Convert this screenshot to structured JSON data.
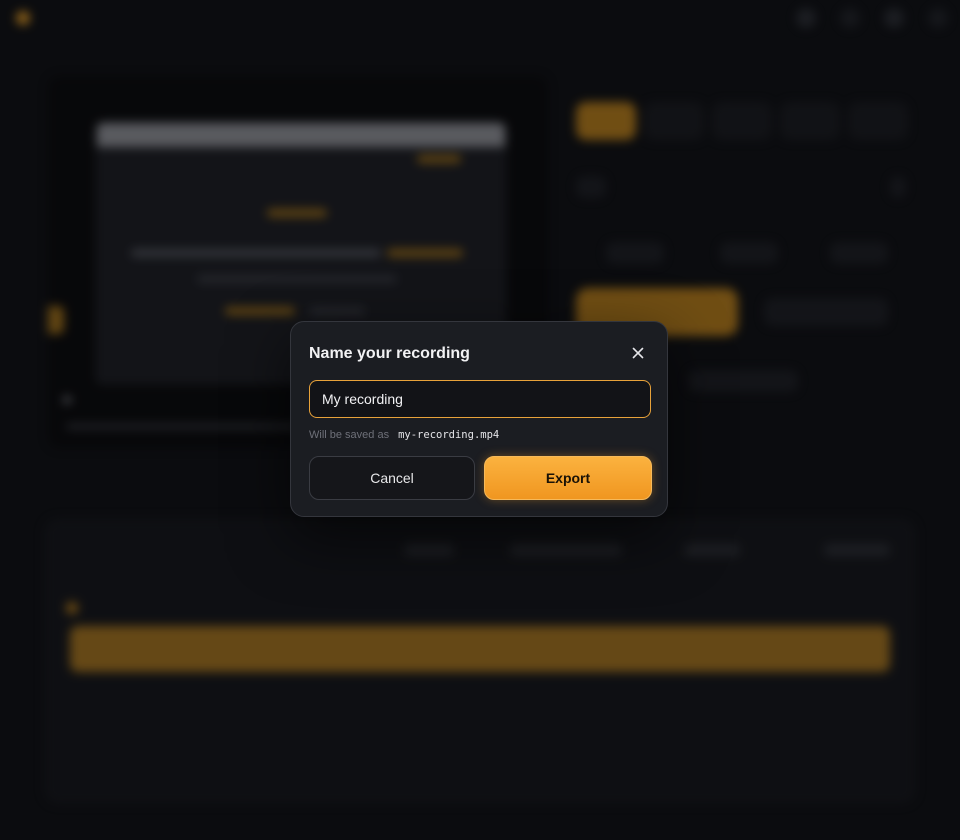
{
  "modal": {
    "title": "Name your recording",
    "close_icon": "close-icon",
    "input": {
      "value": "My recording",
      "placeholder": ""
    },
    "hint_prefix": "Will be saved as",
    "hint_filename": "my-recording.mp4",
    "cancel_label": "Cancel",
    "export_label": "Export"
  },
  "colors": {
    "accent": "#f5a623",
    "background": "#0b0c0f",
    "modal_bg": "#1b1d22",
    "input_border": "#e8a23a"
  }
}
